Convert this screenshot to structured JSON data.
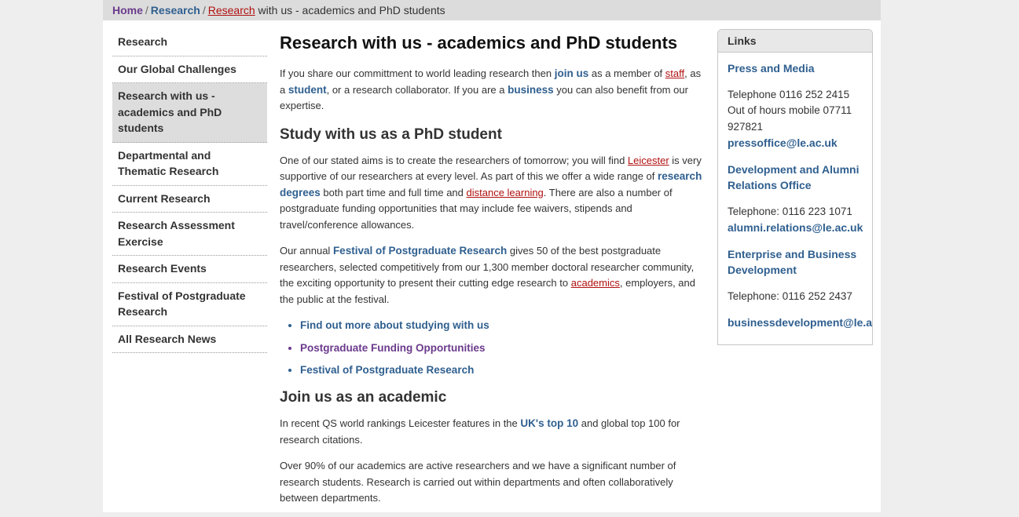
{
  "breadcrumb": {
    "home": "Home",
    "research": "Research",
    "research_link": "Research",
    "current": "with us - academics and PhD students",
    "separator": "/"
  },
  "sidebar": {
    "items": [
      {
        "label": "Research"
      },
      {
        "label": "Our Global Challenges"
      },
      {
        "label": "Research with us - academics and PhD students"
      },
      {
        "label": "Departmental and Thematic Research"
      },
      {
        "label": "Current Research"
      },
      {
        "label": "Research Assessment Exercise"
      },
      {
        "label": "Research Events"
      },
      {
        "label": "Festival of Postgraduate Research"
      },
      {
        "label": "All Research News"
      }
    ]
  },
  "main": {
    "title": "Research with us - academics and PhD students",
    "intro": {
      "t1": "If you share our committment to world leading research then ",
      "join": "join us",
      "t2": " as a member of ",
      "staff": "staff",
      "t3": ", as a ",
      "student": "student",
      "t4": ", or a research collaborator. If you are a ",
      "business": "business",
      "t5": " you can also benefit from our expertise."
    },
    "phd_heading": "Study with us as a PhD student",
    "phd_p1": {
      "t1": "One of our stated aims is to create the researchers of tomorrow; you will find ",
      "leicester": "Leicester",
      "t2": " is very supportive of our researchers at every level. As part of this we offer a wide range of ",
      "degrees": "research degrees",
      "t3": " both part time and full time and ",
      "distance": "distance learning",
      "t4": ". There are also a number of postgraduate funding opportunities that may include fee waivers, stipends and travel/conference allowances."
    },
    "phd_p2": {
      "t1": "Our annual ",
      "festival": "Festival of Postgraduate Research",
      "t2": " gives 50 of the best postgraduate researchers, selected competitively from our 1,300 member doctoral researcher community, the exciting opportunity to present their cutting edge research to ",
      "academics": "academics",
      "t3": ", employers, and the public at the festival."
    },
    "bullets": [
      "Find out more about studying with us",
      "Postgraduate Funding Opportunities",
      "Festival of Postgraduate Research"
    ],
    "academic_heading": "Join us as an academic",
    "acad_p1": {
      "t1": "In recent QS world rankings Leicester features in the ",
      "top10": "UK's top 10",
      "t2": " and global top 100 for research citations."
    },
    "acad_p2": "Over 90% of our academics are active researchers and we have a significant number of research students. Research is carried out within departments and often collaboratively between departments."
  },
  "links": {
    "heading": "Links",
    "press_title": "Press and Media",
    "press_tel": "Telephone 0116 252 2415",
    "press_mobile": "Out of hours mobile 07711 927821",
    "press_email": "pressoffice@le.ac.uk",
    "alumni_title": "Development and Alumni Relations Office",
    "alumni_tel": "Telephone: 0116 223 1071",
    "alumni_email": "alumni.relations@le.ac.uk",
    "enterprise_title": "Enterprise and Business Development",
    "enterprise_tel": "Telephone: 0116 252 2437",
    "enterprise_email": "businessdevelopment@le.ac."
  }
}
